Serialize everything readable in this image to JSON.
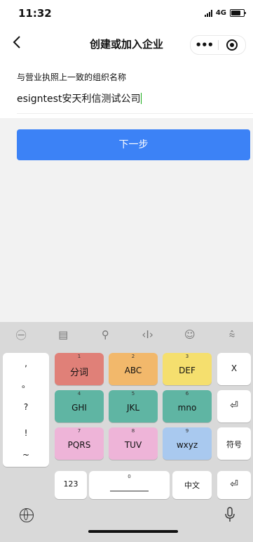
{
  "status_bar": {
    "time": "11:32",
    "network": "4G"
  },
  "nav": {
    "back_icon": "chevron-left-icon",
    "title": "创建或加入企业",
    "more_label": "•••",
    "close_icon": "target-icon"
  },
  "form": {
    "label": "与营业执照上一致的组织名称",
    "value": "esigntest安天利信测试公司",
    "next_button": "下一步"
  },
  "keyboard": {
    "toolbar_icons": [
      "handwriting-icon",
      "clipboard-icon",
      "search-icon",
      "cursor-icon",
      "emoji-icon",
      "collapse-keyboard-icon"
    ],
    "toolbar_glyphs": [
      "㊀",
      "▤",
      "⚲",
      "‹I›",
      "☺",
      "⩯"
    ],
    "punct": [
      ",",
      "。",
      "?",
      "!",
      "~"
    ],
    "keys": [
      {
        "num": "1",
        "label": "分词"
      },
      {
        "num": "2",
        "label": "ABC"
      },
      {
        "num": "3",
        "label": "DEF"
      },
      {
        "num": "4",
        "label": "GHI"
      },
      {
        "num": "5",
        "label": "JKL"
      },
      {
        "num": "6",
        "label": "mno"
      },
      {
        "num": "7",
        "label": "PQRS"
      },
      {
        "num": "8",
        "label": "TUV"
      },
      {
        "num": "9",
        "label": "wxyz"
      }
    ],
    "delete_label": "X",
    "enter_label": "⏎",
    "symbol_label": "符号",
    "num_label": "123",
    "space_num": "0",
    "lang_label": "中文",
    "return_label": "⏎"
  }
}
